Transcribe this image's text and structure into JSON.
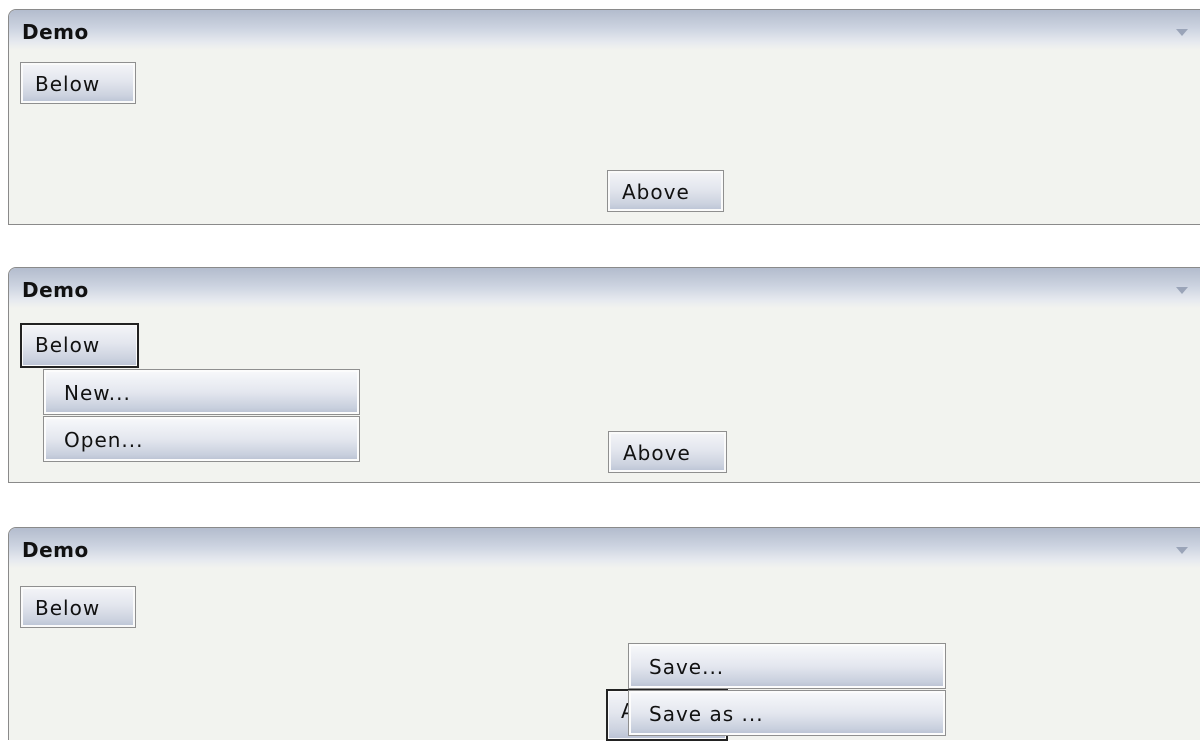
{
  "panels": [
    {
      "title": "Demo",
      "below_label": "Below",
      "above_label": "Above"
    },
    {
      "title": "Demo",
      "below_label": "Below",
      "above_label": "Above",
      "menu": [
        "New...",
        "Open..."
      ]
    },
    {
      "title": "Demo",
      "below_label": "Below",
      "above_label": "Above",
      "menu": [
        "Save...",
        "Save as ..."
      ]
    }
  ],
  "icons": {
    "collapse": "chevron-down-icon"
  }
}
